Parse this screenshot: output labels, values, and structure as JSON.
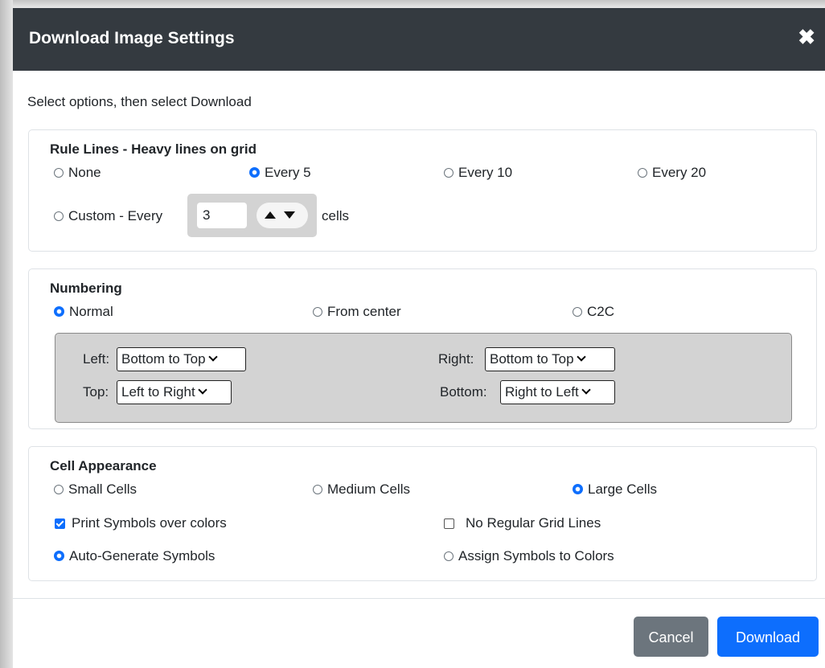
{
  "dialog": {
    "title": "Download Image Settings",
    "close_label": "✖",
    "instructions": "Select options, then select Download"
  },
  "rule_lines": {
    "title": "Rule Lines - Heavy lines on grid",
    "options": [
      {
        "label": "None",
        "selected": false
      },
      {
        "label": "Every 5",
        "selected": true
      },
      {
        "label": "Every 10",
        "selected": false
      },
      {
        "label": "Every 20",
        "selected": false
      }
    ],
    "custom_label": "Custom - Every",
    "custom_selected": false,
    "custom_value": "3",
    "custom_suffix": "cells"
  },
  "numbering": {
    "title": "Numbering",
    "options": [
      {
        "label": "Normal",
        "selected": true
      },
      {
        "label": "From center",
        "selected": false
      },
      {
        "label": "C2C",
        "selected": false
      }
    ],
    "left_label": "Left:",
    "left_value": "Bottom to Top",
    "right_label": "Right:",
    "right_value": "Bottom to Top",
    "top_label": "Top:",
    "top_value": "Left to Right",
    "bottom_label": "Bottom:",
    "bottom_value": "Right to Left"
  },
  "cell_appearance": {
    "title": "Cell Appearance",
    "size_options": [
      {
        "label": "Small Cells",
        "selected": false
      },
      {
        "label": "Medium Cells",
        "selected": false
      },
      {
        "label": "Large Cells",
        "selected": true
      }
    ],
    "print_symbols_label": "Print Symbols over colors",
    "print_symbols_checked": true,
    "no_grid_label": "No Regular Grid Lines",
    "no_grid_checked": false,
    "auto_generate_label": "Auto-Generate Symbols",
    "auto_generate_selected": true,
    "assign_symbols_label": "Assign Symbols to Colors",
    "assign_symbols_selected": false
  },
  "footer": {
    "cancel_label": "Cancel",
    "download_label": "Download"
  },
  "colors": {
    "header_bg": "#343a40",
    "accent": "#0d6efd",
    "cancel_bg": "#6c757d",
    "panel_grey": "#d3d3d3"
  }
}
